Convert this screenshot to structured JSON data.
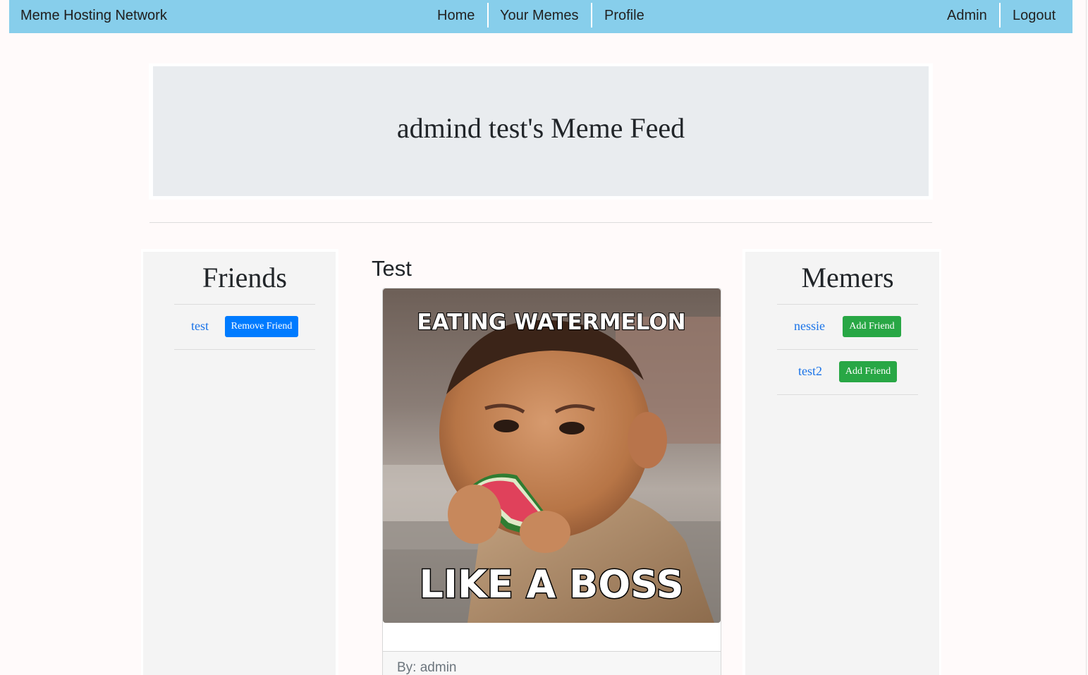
{
  "nav": {
    "brand": "Meme Hosting Network",
    "links": [
      "Home",
      "Your Memes",
      "Profile"
    ],
    "right_links": [
      "Admin",
      "Logout"
    ]
  },
  "header": {
    "title": "admind test's Meme Feed"
  },
  "friends": {
    "title": "Friends",
    "items": [
      {
        "name": "test",
        "action": "Remove Friend"
      }
    ]
  },
  "post": {
    "title": "Test",
    "image": {
      "top_caption": "EATING WATERMELON",
      "bottom_caption": "LIKE A BOSS"
    },
    "byline": "By: admin"
  },
  "memers": {
    "title": "Memers",
    "items": [
      {
        "name": "nessie",
        "action": "Add Friend"
      },
      {
        "name": "test2",
        "action": "Add Friend"
      }
    ]
  },
  "colors": {
    "navbar": "#87ceeb",
    "jumbotron": "#e9ecef",
    "panel": "#f4f4f4",
    "link": "#1a73e8",
    "primary_button": "#007bff",
    "success_button": "#28a745"
  },
  "icons": [
    "meme-photo"
  ]
}
